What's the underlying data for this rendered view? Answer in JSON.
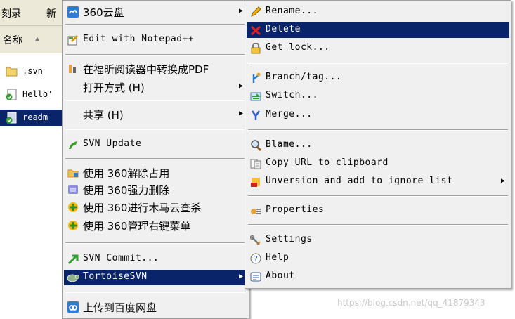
{
  "explorer": {
    "toolbar": {
      "burn": "刻录",
      "new": "新"
    },
    "column_header": "名称",
    "files": [
      {
        "name": ".svn",
        "icon": "folder-icon",
        "selected": false
      },
      {
        "name": "Hello'",
        "icon": "svn-modified-file-icon",
        "selected": false
      },
      {
        "name": "readm",
        "icon": "svn-modified-file-icon",
        "selected": true
      }
    ]
  },
  "main_menu": {
    "items": [
      {
        "label": "360云盘",
        "icon": "360-cloud-icon",
        "submenu": true
      },
      {
        "label": "Edit with Notepad++",
        "icon": "notepad-plus-plus-icon"
      },
      {
        "label": "在福昕阅读器中转换成PDF",
        "icon": "foxit-pdf-icon"
      },
      {
        "label": "打开方式 (H)",
        "icon": "",
        "submenu": true
      },
      {
        "label": "共享 (H)",
        "icon": "",
        "submenu": true
      },
      {
        "label": "SVN Update",
        "icon": "svn-update-icon"
      },
      {
        "label": "使用 360解除占用",
        "icon": "360-unlock-icon"
      },
      {
        "label": "使用 360强力删除",
        "icon": "360-force-delete-icon"
      },
      {
        "label": "使用 360进行木马云查杀",
        "icon": "360-trojan-scan-icon"
      },
      {
        "label": "使用 360管理右键菜单",
        "icon": "360-context-menu-icon"
      },
      {
        "label": "SVN Commit...",
        "icon": "svn-commit-icon"
      },
      {
        "label": "TortoiseSVN",
        "icon": "tortoisesvn-icon",
        "submenu": true
      },
      {
        "label": "上传到百度网盘",
        "icon": "baidu-netdisk-icon"
      }
    ]
  },
  "tortoise_menu": {
    "items": [
      {
        "label": "Rename...",
        "icon": "rename-pencil-icon"
      },
      {
        "label": "Delete",
        "icon": "delete-x-icon"
      },
      {
        "label": "Get lock...",
        "icon": "lock-icon"
      },
      {
        "label": "Branch/tag...",
        "icon": "branch-tag-icon"
      },
      {
        "label": "Switch...",
        "icon": "switch-icon"
      },
      {
        "label": "Merge...",
        "icon": "merge-icon"
      },
      {
        "label": "Blame...",
        "icon": "blame-icon"
      },
      {
        "label": "Copy URL to clipboard",
        "icon": "copy-url-icon"
      },
      {
        "label": "Unversion and add to ignore list",
        "icon": "unversion-ignore-icon",
        "submenu": true
      },
      {
        "label": "Properties",
        "icon": "properties-icon"
      },
      {
        "label": "Settings",
        "icon": "settings-icon"
      },
      {
        "label": "Help",
        "icon": "help-icon"
      },
      {
        "label": "About",
        "icon": "about-icon"
      }
    ]
  },
  "watermark": "https://blog.csdn.net/qq_41879343",
  "colors": {
    "highlight": "#0a246a",
    "menu_bg": "#f0f0f0"
  }
}
